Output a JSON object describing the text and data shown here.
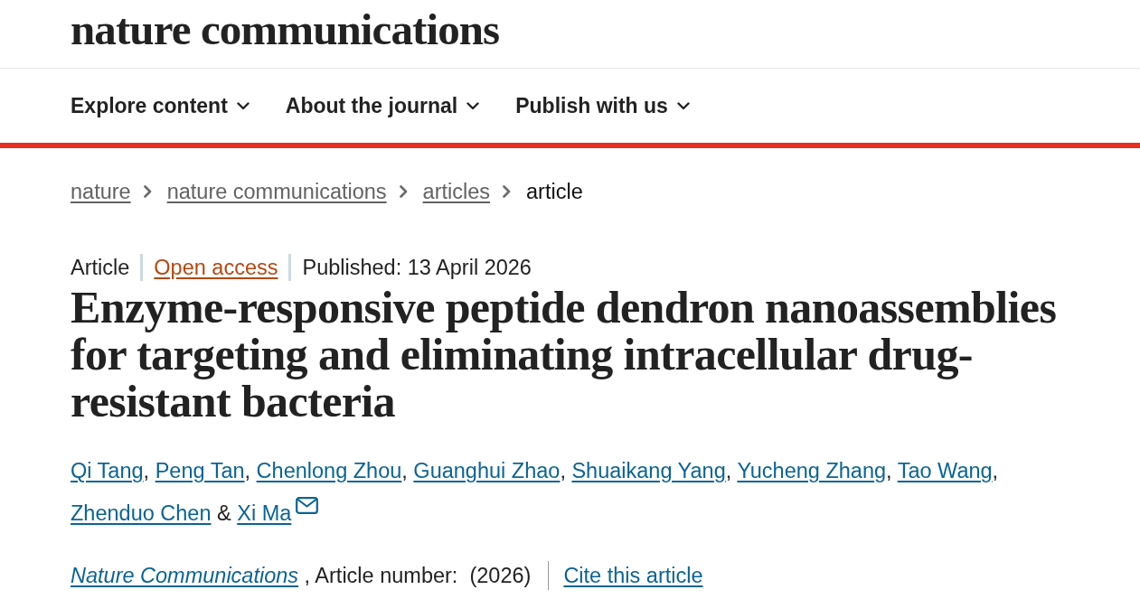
{
  "header": {
    "logo": "nature communications"
  },
  "nav": {
    "items": [
      {
        "label": "Explore content"
      },
      {
        "label": "About the journal"
      },
      {
        "label": "Publish with us"
      }
    ]
  },
  "breadcrumb": [
    {
      "label": "nature",
      "kind": "link"
    },
    {
      "label": "nature communications",
      "kind": "link"
    },
    {
      "label": "articles",
      "kind": "link"
    },
    {
      "label": "article",
      "kind": "current"
    }
  ],
  "article": {
    "meta": [
      {
        "label": "Article",
        "kind": "type"
      },
      {
        "label": "Open access",
        "kind": "access"
      },
      {
        "label": "Published: 13 April 2026",
        "kind": "date"
      }
    ],
    "title": "Enzyme-responsive peptide dendron nanoassemblies for targeting and eliminating intracellular drug-resistant bacteria",
    "authors": [
      {
        "name": "Qi Tang",
        "after": ","
      },
      {
        "name": "Peng Tan",
        "after": ","
      },
      {
        "name": "Chenlong Zhou",
        "after": ","
      },
      {
        "name": "Guanghui Zhao",
        "after": ","
      },
      {
        "name": "Shuaikang Yang",
        "after": ","
      },
      {
        "name": "Yucheng Zhang",
        "after": ","
      },
      {
        "name": "Tao Wang",
        "after": ","
      },
      {
        "name": "Zhenduo Chen",
        "after": "&"
      },
      {
        "name": "Xi Ma",
        "corresponding": true
      }
    ],
    "citation": {
      "journal": "Nature Communications",
      "details": ", Article number:  (2026)",
      "cite_link": "Cite this article"
    }
  }
}
